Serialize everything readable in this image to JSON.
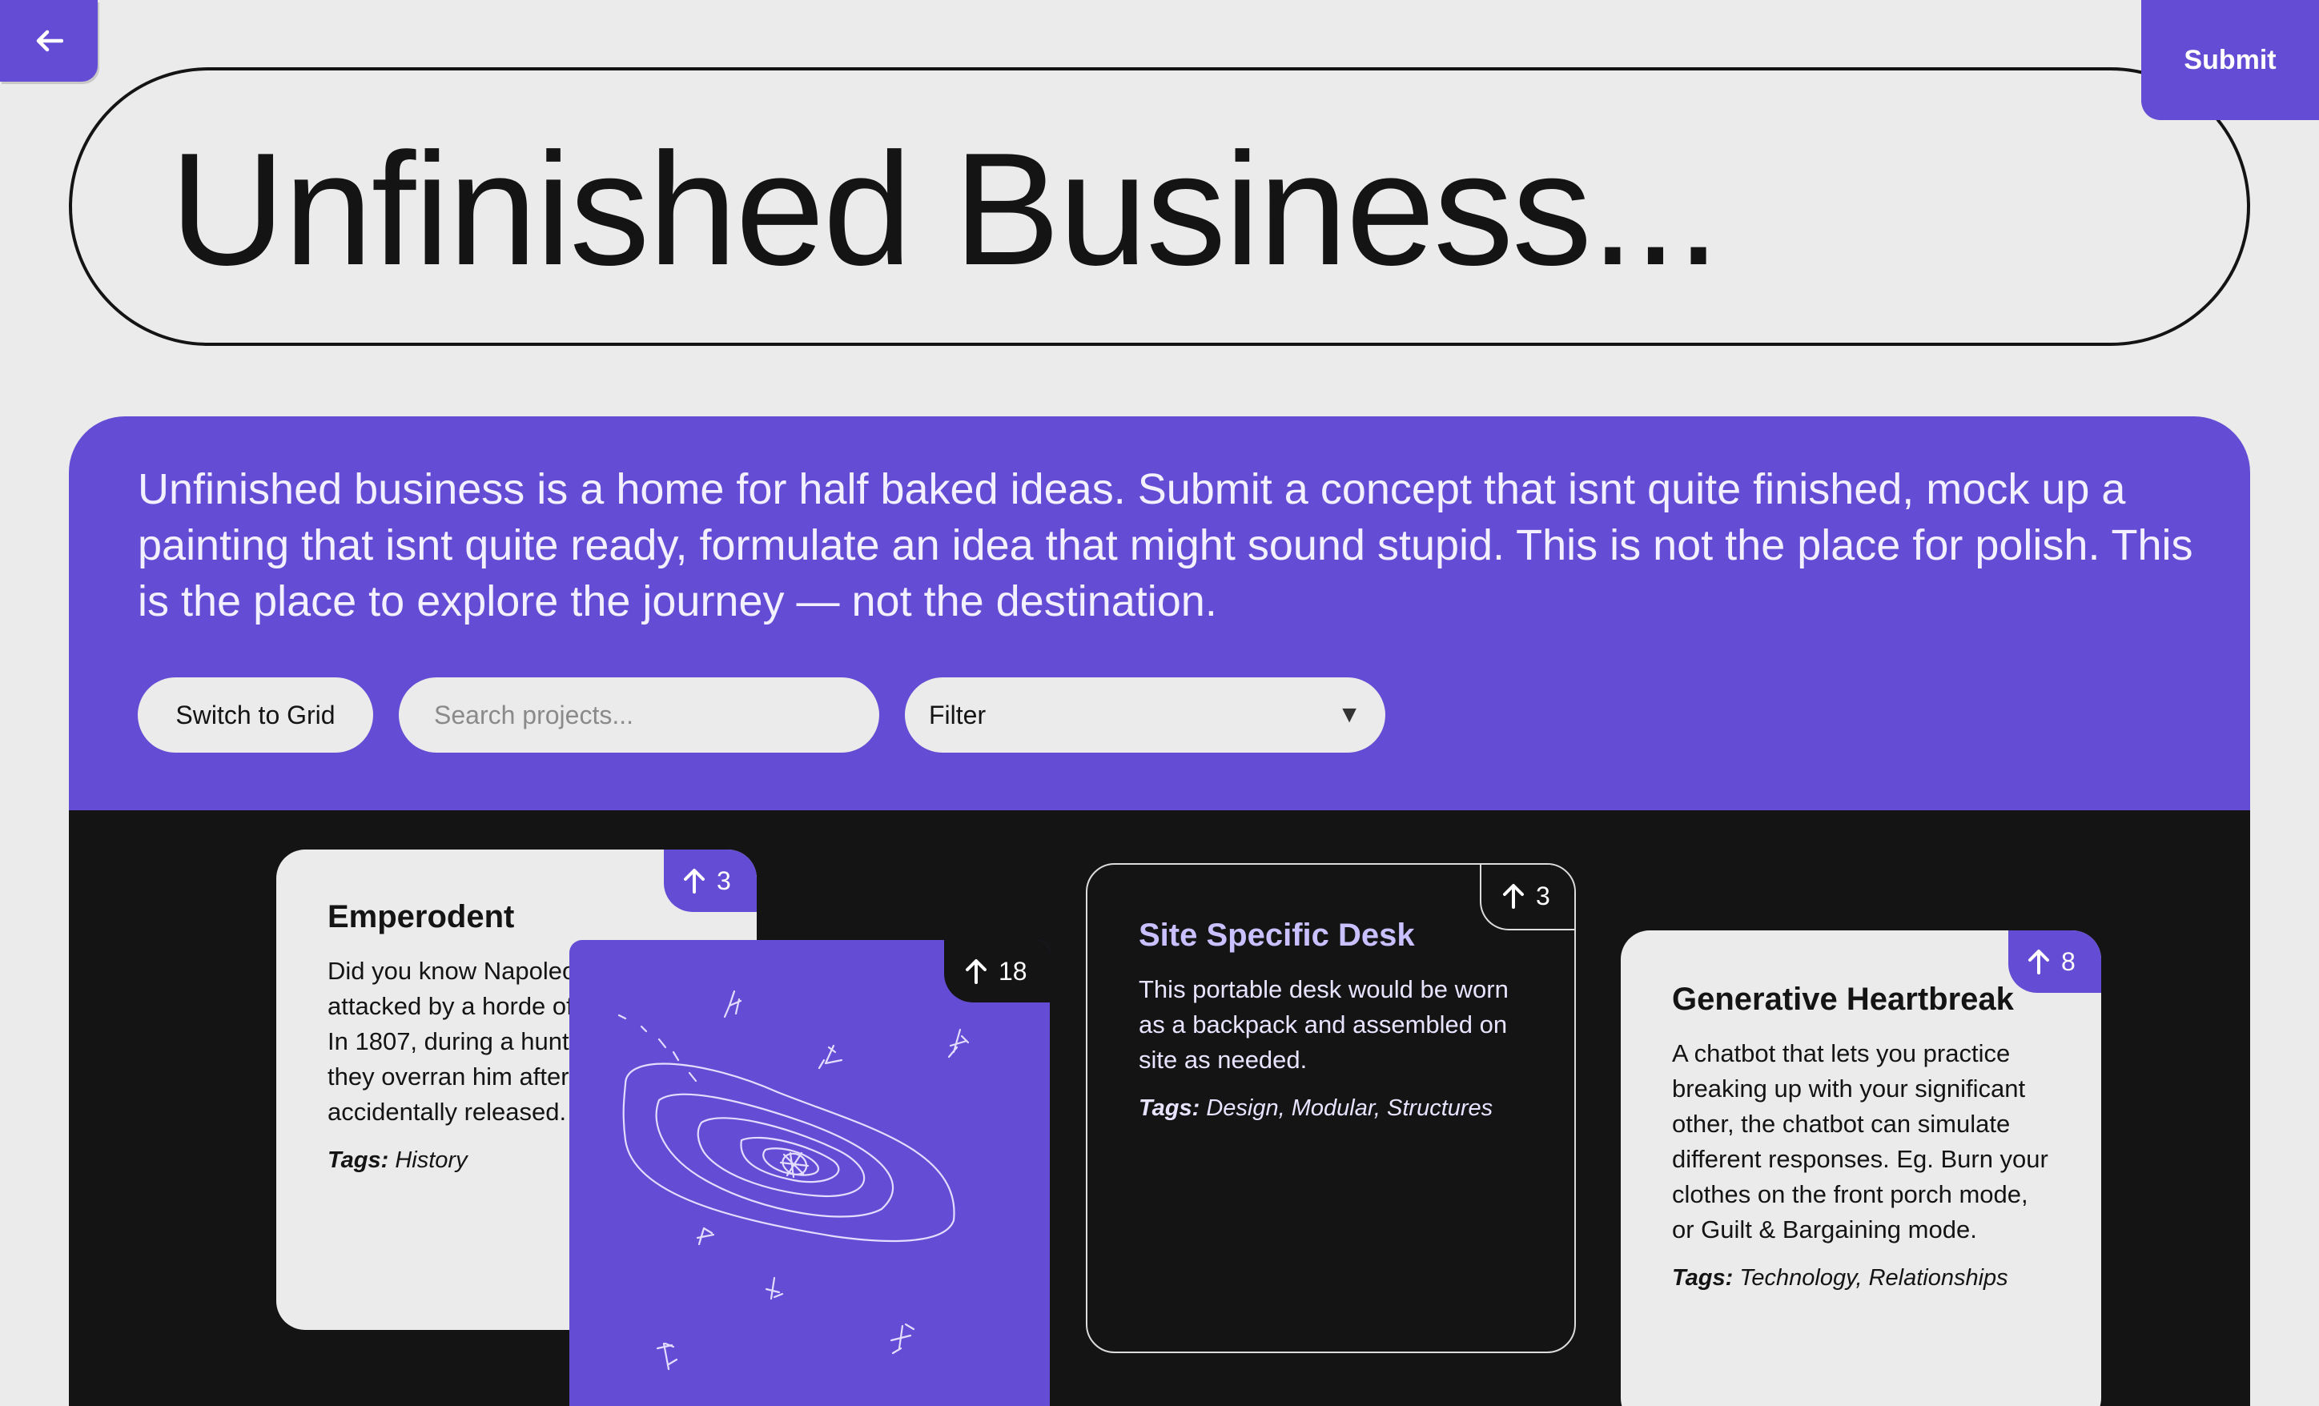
{
  "nav": {
    "back_icon": "arrow-left-icon",
    "submit_label": "Submit"
  },
  "header": {
    "title": "Unfinished Business..."
  },
  "intro": {
    "text": "Unfinished business is a home for half baked ideas. Submit a concept that isnt quite finished, mock up a painting that isnt quite ready, formulate an idea that might sound stupid. This is not the place for polish. This is the place to explore the journey — not the destination."
  },
  "controls": {
    "switch_label": "Switch to Grid",
    "search_placeholder": "Search projects...",
    "filter_label": "Filter",
    "filter_arrow": "▼"
  },
  "colors": {
    "accent": "#644dd4",
    "board": "#141414",
    "page": "#ebebeb"
  },
  "cards": [
    {
      "title": "Emperodent",
      "votes": "3",
      "description": "Did you know Napoleon was once attacked by a horde of bunnies? In 1807, during a hunting party, they overran him after being accidentally released.",
      "tags_label": "Tags:",
      "tags": "History"
    },
    {
      "type": "image",
      "votes": "18",
      "image": "galaxy-sketch-drawing"
    },
    {
      "title": "Site Specific Desk",
      "votes": "3",
      "description": "This portable desk would be worn as a backpack and assembled on site as needed.",
      "tags_label": "Tags:",
      "tags": "Design, Modular, Structures"
    },
    {
      "title": "Generative Heartbreak",
      "votes": "8",
      "description": "A chatbot that lets you practice breaking up with your significant other, the chatbot can simulate different responses. Eg. Burn your clothes on the front porch mode, or Guilt & Bargaining mode.",
      "tags_label": "Tags:",
      "tags": "Technology, Relationships"
    }
  ]
}
